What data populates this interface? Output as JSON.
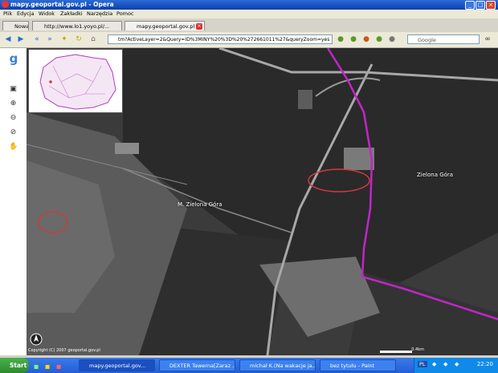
{
  "window": {
    "title": "mapy.geoportal.gov.pl - Opera",
    "controls": {
      "minimize": "_",
      "maximize": "□",
      "close": "×"
    }
  },
  "menu": {
    "items": [
      "Plik",
      "Edycja",
      "Widok",
      "Zakładki",
      "Narzędzia",
      "Pomoc"
    ]
  },
  "tabs": {
    "new_tab_label": "Nowa",
    "items": [
      {
        "label": "http://www.lo1.yoyo.pl/..."
      },
      {
        "label": "mapy.geoportal.gov.pl"
      }
    ],
    "close_label": "×"
  },
  "navbar": {
    "address": "tm?ActiveLayer=2&Query=ID%3MINY%20%3D%20%272661011%27&queryZoom=yes",
    "search_placeholder": "Google",
    "icons": [
      "back-icon",
      "forward-icon",
      "rewind-icon",
      "fast-forward-icon",
      "reload-icon",
      "home-icon",
      "wand-icon"
    ]
  },
  "map": {
    "labels": {
      "city": "M. Zielona Góra",
      "gmina": "Zielona Góra"
    },
    "copyright": "Copyright (C) 2007 geoportal.gov.pl",
    "scale_label": "0.4km",
    "accent_color": "#c026c6",
    "annotation_color": "#d23a3a"
  },
  "taskbar": {
    "start_label": "Start",
    "tasks": [
      {
        "label": "mapy.geoportal.gov..."
      },
      {
        "label": "DEXTER Tawerna[Zaraz ..."
      },
      {
        "label": "michał K.(Na wakacje ja..."
      },
      {
        "label": "bez tytułu - Paint"
      }
    ],
    "clock": "22:20",
    "tray_label": "PL"
  }
}
